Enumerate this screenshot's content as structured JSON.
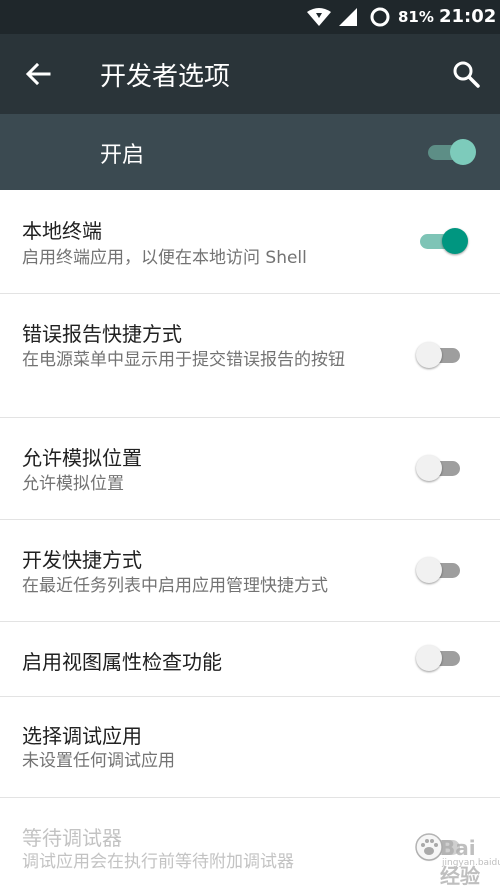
{
  "status_bar": {
    "battery_percent": "81%",
    "time": "21:02",
    "icons": [
      "wifi-icon",
      "cell-signal-icon",
      "battery-ring-icon"
    ]
  },
  "app_bar": {
    "title": "开发者选项",
    "icons": [
      "back-arrow-icon",
      "search-icon"
    ]
  },
  "master": {
    "label": "开启",
    "enabled": true
  },
  "settings": [
    {
      "title": "本地终端",
      "summary": "启用终端应用，以便在本地访问 Shell",
      "enabled": true,
      "disabled": false
    },
    {
      "title": "错误报告快捷方式",
      "summary": "在电源菜单中显示用于提交错误报告的按钮",
      "enabled": false,
      "disabled": false
    },
    {
      "title": "允许模拟位置",
      "summary": "允许模拟位置",
      "enabled": false,
      "disabled": false
    },
    {
      "title": "开发快捷方式",
      "summary": "在最近任务列表中启用应用管理快捷方式",
      "enabled": false,
      "disabled": false
    },
    {
      "title": "启用视图属性检查功能",
      "summary": "",
      "enabled": false,
      "disabled": false
    },
    {
      "title": "选择调试应用",
      "summary": "未设置任何调试应用",
      "enabled": null,
      "disabled": false
    },
    {
      "title": "等待调试器",
      "summary": "调试应用会在执行前等待附加调试器",
      "enabled": false,
      "disabled": true
    }
  ],
  "watermark": {
    "text": "Bai 经验",
    "url": "jingyan.baidu.com"
  },
  "colors": {
    "status_bar": "#1f272b",
    "app_bar": "#2a3439",
    "master_bar": "#3b4a51",
    "accent": "#009680"
  }
}
